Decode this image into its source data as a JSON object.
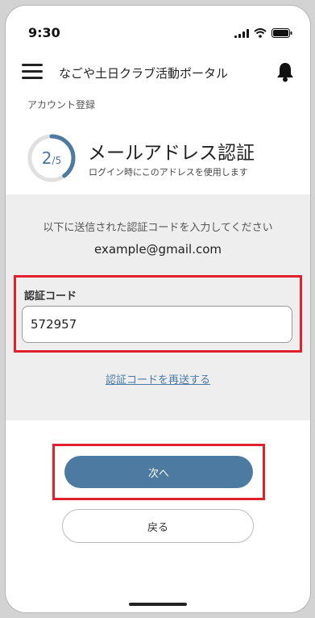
{
  "status_bar": {
    "time": "9:30"
  },
  "header": {
    "title": "なごや土日クラブ活動ポータル"
  },
  "section_label": "アカウント登録",
  "progress": {
    "current": "2",
    "separator": "/",
    "total": "5",
    "fraction": 0.4
  },
  "page": {
    "heading": "メールアドレス認証",
    "subtext": "ログイン時にこのアドレスを使用します"
  },
  "verification": {
    "instruction": "以下に送信された認証コードを入力してください",
    "email": "example@gmail.com",
    "code_label": "認証コード",
    "code_value": "572957",
    "resend_label": "認証コードを再送する"
  },
  "actions": {
    "next_label": "次へ",
    "back_label": "戻る"
  },
  "colors": {
    "accent": "#4c7aa0",
    "highlight": "#e0202a",
    "panel": "#eeeeee"
  }
}
